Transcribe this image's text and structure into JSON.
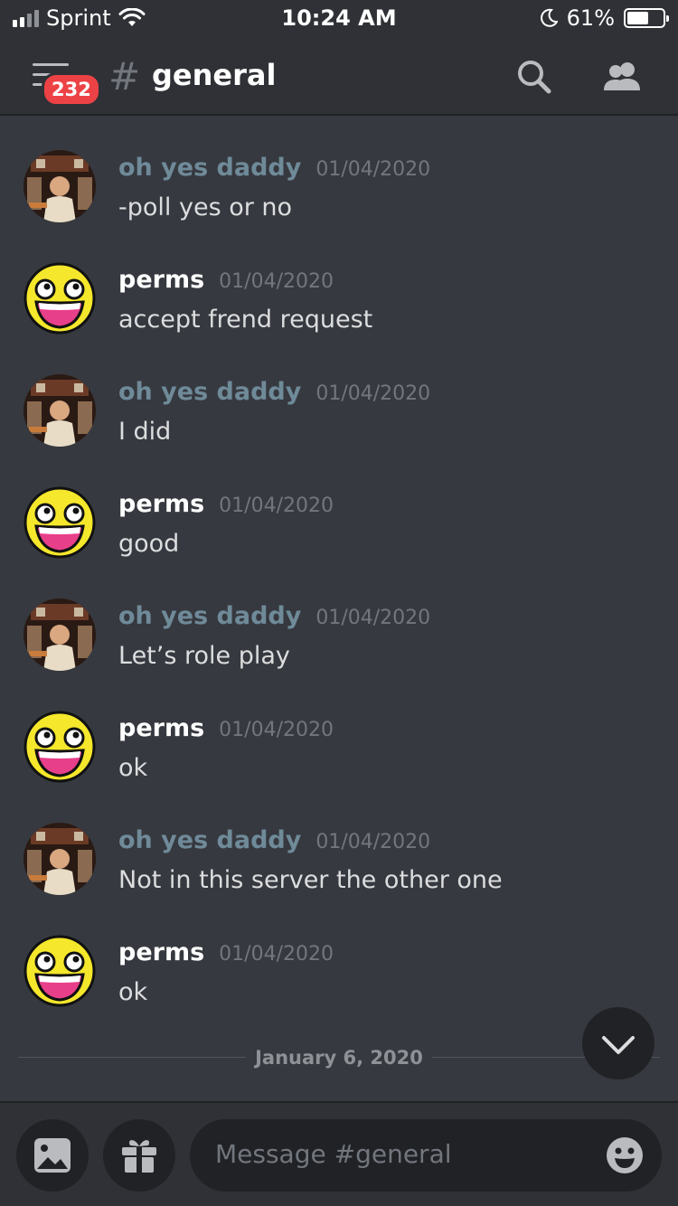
{
  "status_bar": {
    "carrier": "Sprint",
    "time": "10:24 AM",
    "battery": "61%",
    "battery_level": 0.61
  },
  "header": {
    "badge": "232",
    "hash": "#",
    "channel": "general"
  },
  "messages": [
    {
      "author": "oh yes daddy",
      "timestamp": "01/04/2020",
      "text": "-poll yes or no"
    },
    {
      "author": "perms",
      "timestamp": "01/04/2020",
      "text": "accept frend request"
    },
    {
      "author": "oh yes daddy",
      "timestamp": "01/04/2020",
      "text": "I did"
    },
    {
      "author": "perms",
      "timestamp": "01/04/2020",
      "text": "good"
    },
    {
      "author": "oh yes daddy",
      "timestamp": "01/04/2020",
      "text": "Let’s role play"
    },
    {
      "author": "perms",
      "timestamp": "01/04/2020",
      "text": "ok"
    },
    {
      "author": "oh yes daddy",
      "timestamp": "01/04/2020",
      "text": "Not in this server the other one"
    },
    {
      "author": "perms",
      "timestamp": "01/04/2020",
      "text": "ok"
    }
  ],
  "date_divider": "January 6, 2020",
  "composer": {
    "placeholder": "Message #general"
  },
  "colors": {
    "background": "#36393f",
    "header": "#2f3136",
    "badge": "#ed4245",
    "author_a": "#6f8a99",
    "author_b": "#ffffff"
  },
  "icons": [
    "signal-icon",
    "wifi-icon",
    "moon-icon",
    "battery-icon",
    "hamburger-icon",
    "search-icon",
    "members-icon",
    "chevron-down-icon",
    "image-icon",
    "gift-icon",
    "emoji-icon"
  ]
}
